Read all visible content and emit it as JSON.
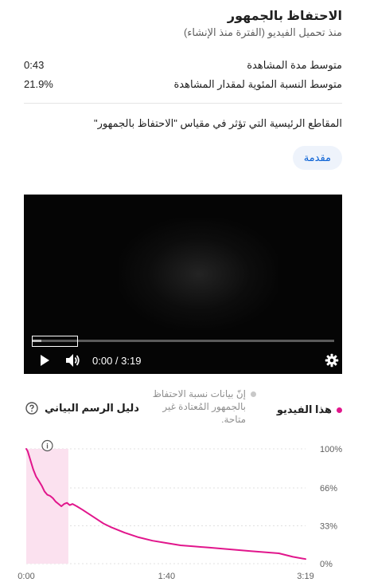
{
  "header": {
    "title": "الاحتفاظ بالجمهور",
    "subtitle": "منذ تحميل الفيديو (الفترة منذ الإنشاء)"
  },
  "stats": [
    {
      "label": "متوسط مدة المشاهدة",
      "value": "0:43"
    },
    {
      "label": "متوسط النسبة المئوية لمقدار المشاهدة",
      "value": "21.9%"
    }
  ],
  "moments": {
    "title": "المقاطع الرئيسية التي تؤثر في مقياس \"الاحتفاظ بالجمهور\"",
    "chips": [
      "مقدمة"
    ]
  },
  "player": {
    "time": "0:00 / 3:19",
    "progress_fraction": 0.0,
    "icons": [
      "play-icon",
      "volume-icon",
      "gear-icon"
    ]
  },
  "legend": {
    "this_video": "هذا الفيديو",
    "typical_unavailable": "إنّ بيانات نسبة الاحتفاظ بالجمهور المُعتادة غير متاحة.",
    "guide": "دليل الرسم البياني",
    "this_video_color": "#e1168c",
    "typical_color": "#c8c8c8"
  },
  "chart_data": {
    "type": "line",
    "ylim": [
      0,
      100
    ],
    "yticks": [
      "100%",
      "66%",
      "33%",
      "0%"
    ],
    "ytick_values": [
      100,
      66,
      33,
      0
    ],
    "xlim": [
      0,
      199
    ],
    "xticks": [
      "0:00",
      "1:40",
      "3:19"
    ],
    "xtick_values": [
      0,
      100,
      199
    ],
    "highlight_range": [
      0,
      30
    ],
    "highlight_label": "مقدمة",
    "series": [
      {
        "color": "#e1168c",
        "x": [
          0,
          1,
          3,
          5,
          7,
          9,
          11,
          13,
          15,
          17,
          19,
          21,
          23,
          25,
          27,
          29,
          31,
          33,
          36,
          40,
          45,
          50,
          55,
          60,
          70,
          80,
          90,
          100,
          110,
          120,
          130,
          140,
          150,
          160,
          170,
          180,
          190,
          199
        ],
        "y": [
          100,
          98,
          90,
          82,
          76,
          72,
          68,
          63,
          60,
          59,
          57,
          54,
          52,
          50,
          52,
          53,
          51,
          52,
          50,
          47,
          43,
          39,
          35,
          32,
          27,
          23,
          20,
          18,
          16,
          15,
          14,
          13,
          12,
          11,
          10,
          9,
          6,
          4
        ]
      }
    ]
  }
}
